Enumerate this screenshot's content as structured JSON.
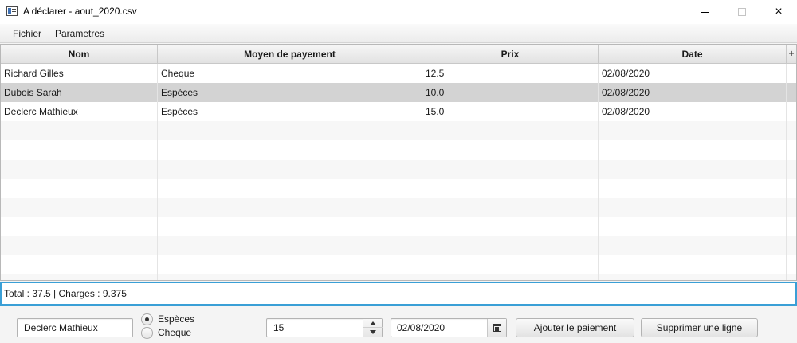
{
  "window": {
    "title": "A déclarer - aout_2020.csv",
    "controls": {
      "minimize": "minimize-icon",
      "maximize": "maximize-icon",
      "close": "×"
    }
  },
  "menu": {
    "items": [
      {
        "label": "Fichier"
      },
      {
        "label": "Parametres"
      }
    ]
  },
  "table": {
    "columns": [
      "Nom",
      "Moyen de payement",
      "Prix",
      "Date"
    ],
    "menu_button": "+",
    "rows": [
      {
        "nom": "Richard Gilles",
        "moyen": "Cheque",
        "prix": "12.5",
        "date": "02/08/2020"
      },
      {
        "nom": "Dubois Sarah",
        "moyen": "Espèces",
        "prix": "10.0",
        "date": "02/08/2020"
      },
      {
        "nom": "Declerc Mathieux",
        "moyen": "Espèces",
        "prix": "15.0",
        "date": "02/08/2020"
      }
    ],
    "selected_row": 1
  },
  "summary": {
    "text": "Total : 37.5 | Charges : 9.375"
  },
  "form": {
    "name_value": "Declerc Mathieux",
    "payment_options": [
      "Espèces",
      "Cheque"
    ],
    "payment_selected": "Espèces",
    "price_value": "15",
    "date_value": "02/08/2020",
    "add_button": "Ajouter le paiement",
    "delete_button": "Supprimer une ligne"
  },
  "colors": {
    "selection": "#d3d3d3",
    "focus_border": "#3a9fd6"
  }
}
